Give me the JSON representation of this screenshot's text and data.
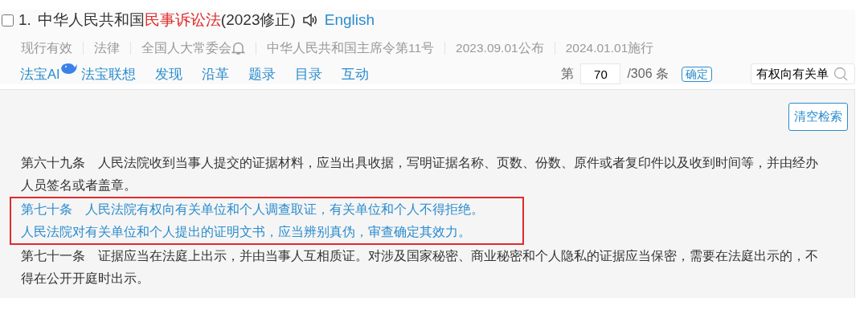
{
  "title": {
    "checked": false,
    "number": "1.",
    "parts": [
      {
        "text": "中华人民共和国",
        "highlight": false
      },
      {
        "text": "民事诉讼法",
        "highlight": true
      },
      {
        "text": "(2023修正)",
        "highlight": false
      }
    ],
    "english": "English"
  },
  "meta": [
    {
      "text": "现行有效",
      "kind": "plain"
    },
    {
      "text": "法律",
      "kind": "plain"
    },
    {
      "text": "全国人大常委会",
      "kind": "bell"
    },
    {
      "text": "中华人民共和国主席令第11号",
      "kind": "plain"
    },
    {
      "text": "2023.09.01公布",
      "kind": "plain"
    },
    {
      "text": "2024.01.01施行",
      "kind": "plain"
    }
  ],
  "nav": [
    {
      "label": "法宝AI",
      "kind": "ai"
    },
    {
      "label": "法宝联想",
      "kind": "link"
    },
    {
      "label": "发现",
      "kind": "link"
    },
    {
      "label": "沿革",
      "kind": "link"
    },
    {
      "label": "题录",
      "kind": "link"
    },
    {
      "label": "目录",
      "kind": "link"
    },
    {
      "label": "互动",
      "kind": "link"
    }
  ],
  "pager": {
    "prefix": "第",
    "value": "70",
    "suffix": "/306 条",
    "confirm": "确定"
  },
  "search": {
    "value": "有权向有关单"
  },
  "clear_button": "清空检索",
  "blocks": [
    {
      "highlighted": false,
      "paragraphs": [
        "第六十九条　人民法院收到当事人提交的证据材料，应当出具收据，写明证据名称、页数、份数、原件或者复印件以及收到时间等，并由经办人员签名或者盖章。"
      ]
    },
    {
      "highlighted": true,
      "paragraphs": [
        "第七十条　人民法院有权向有关单位和个人调查取证，有关单位和个人不得拒绝。",
        "人民法院对有关单位和个人提出的证明文书，应当辨别真伪，审查确定其效力。"
      ]
    },
    {
      "highlighted": false,
      "paragraphs": [
        "第七十一条　证据应当在法庭上出示，并由当事人互相质证。对涉及国家秘密、商业秘密和个人隐私的证据应当保密，需要在法庭出示的，不得在公开开庭时出示。"
      ]
    }
  ]
}
